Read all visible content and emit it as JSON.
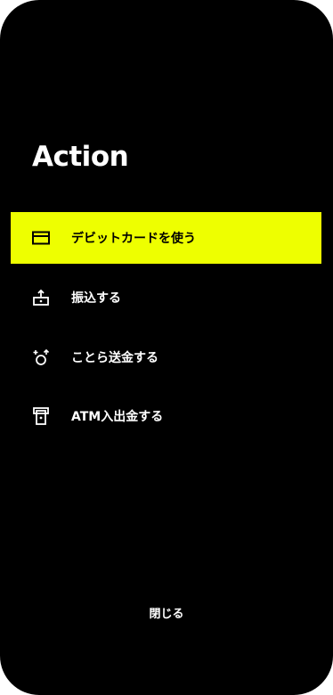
{
  "sheet": {
    "title": "Action",
    "items": [
      {
        "label": "デビットカードを使う",
        "icon": "card-icon",
        "active": true
      },
      {
        "label": "振込する",
        "icon": "transfer-icon",
        "active": false
      },
      {
        "label": "ことら送金する",
        "icon": "send-money-icon",
        "active": false
      },
      {
        "label": "ATM入出金する",
        "icon": "atm-icon",
        "active": false
      }
    ],
    "close_label": "閉じる"
  },
  "colors": {
    "background": "#000000",
    "accent": "#eeff00",
    "text": "#ffffff"
  }
}
